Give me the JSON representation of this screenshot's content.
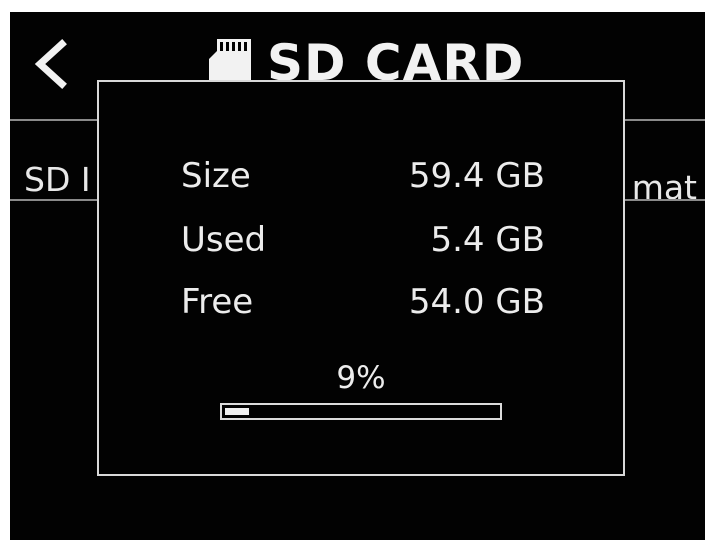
{
  "header": {
    "back_icon": "chevron-left-icon",
    "sd_icon": "sd-card-icon",
    "title": "SD CARD"
  },
  "menu": {
    "left_label": "SD I",
    "right_label": "mat"
  },
  "storage_popup": {
    "size_label": "Size",
    "size_value": "59.4 GB",
    "used_label": "Used",
    "used_value": "5.4 GB",
    "free_label": "Free",
    "free_value": "54.0 GB",
    "percent_text": "9%",
    "progress_fraction": 0.09
  },
  "colors": {
    "background": "#020202",
    "text": "#ececec",
    "divider": "#8a8a8a",
    "border": "#d8d8d8"
  }
}
